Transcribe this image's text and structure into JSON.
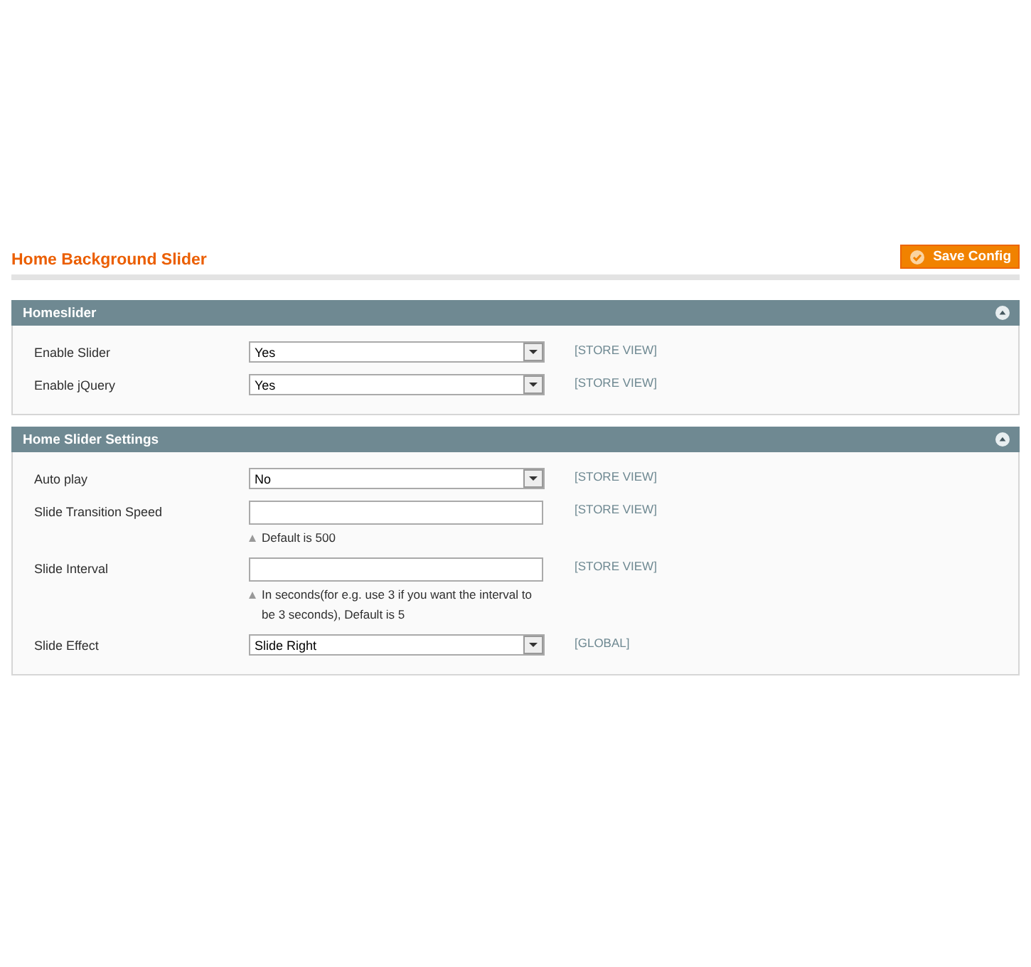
{
  "page_title": "Home Background Slider",
  "save_button": {
    "label": "Save Config"
  },
  "sections": [
    {
      "title": "Homeslider",
      "expanded": true,
      "fields": [
        {
          "label": "Enable Slider",
          "kind": "select",
          "value": "Yes",
          "scope": "[STORE VIEW]"
        },
        {
          "label": "Enable jQuery",
          "kind": "select",
          "value": "Yes",
          "scope": "[STORE VIEW]"
        }
      ]
    },
    {
      "title": "Home Slider Settings",
      "expanded": true,
      "fields": [
        {
          "label": "Auto play",
          "kind": "select",
          "value": "No",
          "scope": "[STORE VIEW]"
        },
        {
          "label": "Slide Transition Speed",
          "kind": "text",
          "scope": "[STORE VIEW]",
          "note": "Default is 500"
        },
        {
          "label": "Slide Interval",
          "kind": "text",
          "scope": "[STORE VIEW]",
          "note": "In seconds(for e.g. use 3 if you want the interval to be 3 seconds), Default is 5"
        },
        {
          "label": "Slide Effect",
          "kind": "select",
          "value": "Slide Right",
          "scope": "[GLOBAL]"
        }
      ]
    }
  ]
}
